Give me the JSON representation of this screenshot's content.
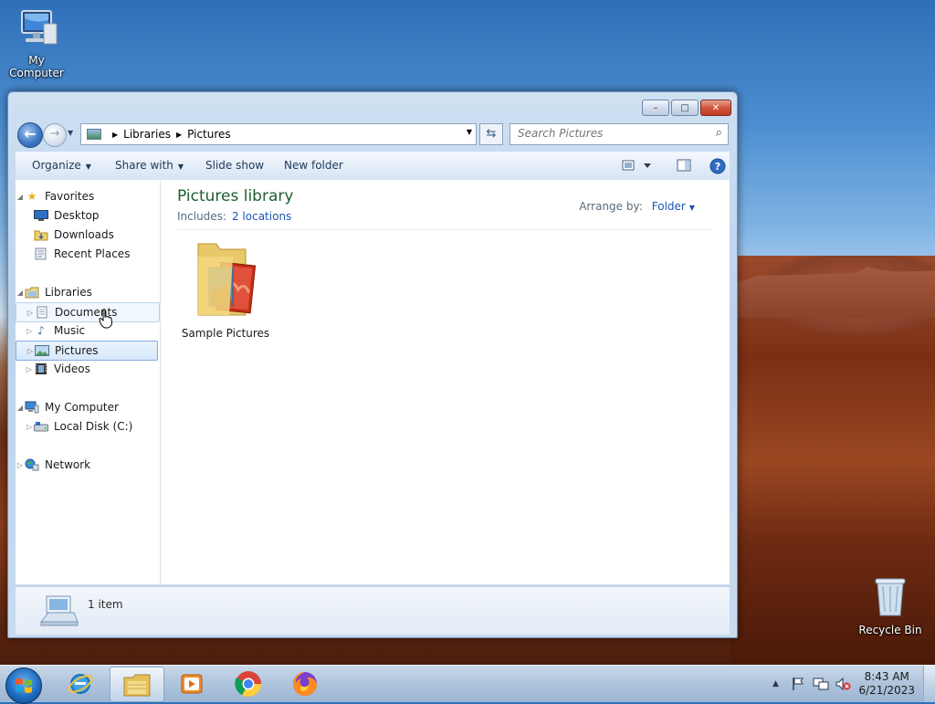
{
  "desktop": {
    "icons": [
      {
        "label": "My Computer"
      },
      {
        "label": "Recycle Bin"
      }
    ]
  },
  "window": {
    "controls": {
      "minimize": "–",
      "maximize": "□",
      "close": "✕"
    },
    "address": {
      "crumbs": [
        "Libraries",
        "Pictures"
      ]
    },
    "search": {
      "placeholder": "Search Pictures"
    },
    "toolbar": {
      "organize": "Organize",
      "share_with": "Share with",
      "slide_show": "Slide show",
      "new_folder": "New folder"
    },
    "nav": {
      "favorites": "Favorites",
      "desktop": "Desktop",
      "downloads": "Downloads",
      "recent_places": "Recent Places",
      "libraries": "Libraries",
      "documents": "Documents",
      "music": "Music",
      "pictures": "Pictures",
      "videos": "Videos",
      "my_computer": "My Computer",
      "local_disk": "Local Disk (C:)",
      "network": "Network"
    },
    "main": {
      "title": "Pictures library",
      "includes_label": "Includes:",
      "includes_link": "2 locations",
      "arrange_label": "Arrange by:",
      "arrange_value": "Folder",
      "items": [
        {
          "label": "Sample Pictures"
        }
      ]
    },
    "details": {
      "count": "1 item"
    }
  },
  "taskbar": {
    "clock_time": "8:43 AM",
    "clock_date": "6/21/2023",
    "tray_arrow": "▲"
  },
  "colors": {
    "library_title": "#1e5f2b",
    "link": "#1e56b3",
    "selection": "#d7e8fb"
  }
}
